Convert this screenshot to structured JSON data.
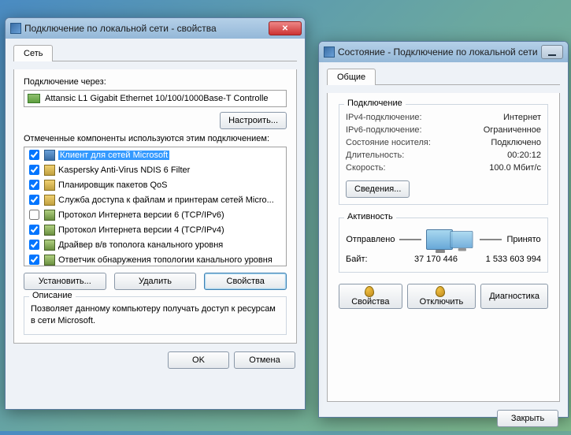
{
  "props": {
    "title": "Подключение по локальной сети - свойства",
    "tab": "Сеть",
    "connect_via_label": "Подключение через:",
    "adapter": "Attansic L1 Gigabit Ethernet 10/100/1000Base-T Controlle",
    "configure_btn": "Настроить...",
    "components_label": "Отмеченные компоненты используются этим подключением:",
    "components": [
      {
        "checked": true,
        "icon": "client",
        "text": "Клиент для сетей Microsoft",
        "selected": true
      },
      {
        "checked": true,
        "icon": "svc",
        "text": "Kaspersky Anti-Virus NDIS 6 Filter",
        "selected": false
      },
      {
        "checked": true,
        "icon": "svc",
        "text": "Планировщик пакетов QoS",
        "selected": false
      },
      {
        "checked": true,
        "icon": "svc",
        "text": "Служба доступа к файлам и принтерам сетей Micro...",
        "selected": false
      },
      {
        "checked": false,
        "icon": "proto",
        "text": "Протокол Интернета версии 6 (TCP/IPv6)",
        "selected": false
      },
      {
        "checked": true,
        "icon": "proto",
        "text": "Протокол Интернета версии 4 (TCP/IPv4)",
        "selected": false
      },
      {
        "checked": true,
        "icon": "proto",
        "text": "Драйвер в/в тополога канального уровня",
        "selected": false
      },
      {
        "checked": true,
        "icon": "proto",
        "text": "Ответчик обнаружения топологии канального уровня",
        "selected": false
      }
    ],
    "install_btn": "Установить...",
    "remove_btn": "Удалить",
    "properties_btn": "Свойства",
    "description_header": "Описание",
    "description_text": "Позволяет данному компьютеру получать доступ к ресурсам в сети Microsoft.",
    "ok_btn": "OK",
    "cancel_btn": "Отмена"
  },
  "status": {
    "title": "Состояние - Подключение по локальной сети",
    "tab": "Общие",
    "connection_header": "Подключение",
    "rows": {
      "ipv4_label": "IPv4-подключение:",
      "ipv4_value": "Интернет",
      "ipv6_label": "IPv6-подключение:",
      "ipv6_value": "Ограниченное",
      "media_label": "Состояние носителя:",
      "media_value": "Подключено",
      "duration_label": "Длительность:",
      "duration_value": "00:20:12",
      "speed_label": "Скорость:",
      "speed_value": "100.0 Мбит/с"
    },
    "details_btn": "Сведения...",
    "activity_header": "Активность",
    "sent_label": "Отправлено",
    "recv_label": "Принято",
    "bytes_label": "Байт:",
    "bytes_sent": "37 170 446",
    "bytes_recv": "1 533 603 994",
    "props_btn": "Свойства",
    "disable_btn": "Отключить",
    "diag_btn": "Диагностика",
    "close_btn": "Закрыть"
  }
}
